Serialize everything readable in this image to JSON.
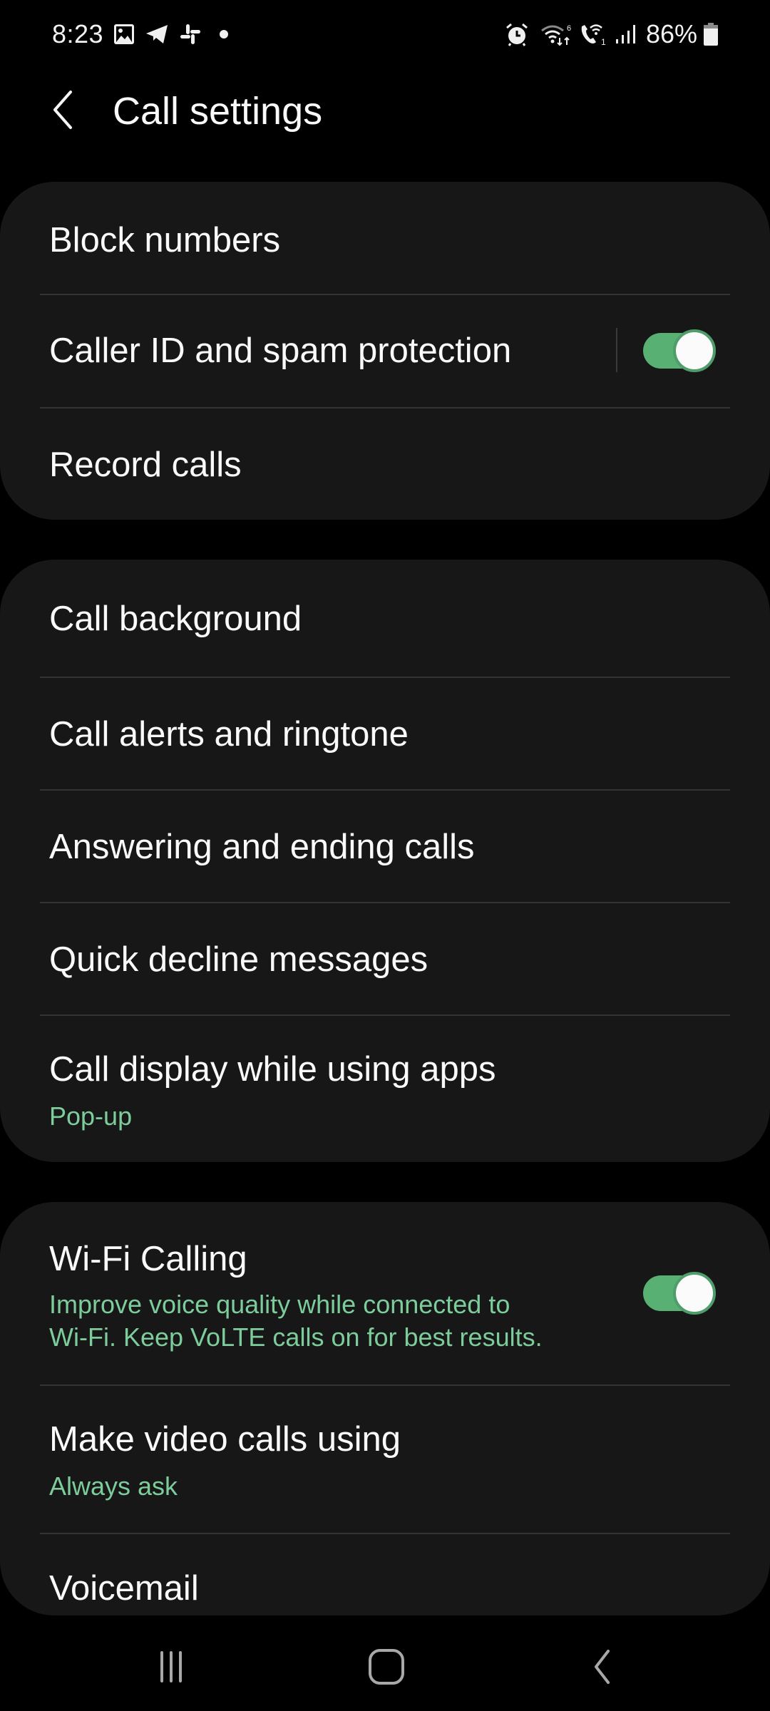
{
  "status_bar": {
    "time": "8:23",
    "left_icons": [
      "gallery-icon",
      "telegram-icon",
      "slack-icon",
      "notification-dot-icon"
    ],
    "right_icons": [
      "alarm-icon",
      "wifi-6-icon",
      "wifi-calling-icon",
      "signal-icon",
      "battery-icon"
    ],
    "wifi_calling_sim": "1",
    "wifi_generation": "6",
    "battery_percent": "86%"
  },
  "header": {
    "back_icon": "chevron-left-icon",
    "title": "Call settings"
  },
  "colors": {
    "accent": "#58b072",
    "subtext": "#7ccc9c",
    "card_bg": "#171717",
    "background": "#000000"
  },
  "groups": [
    {
      "items": [
        {
          "title": "Block numbers"
        },
        {
          "title": "Caller ID and spam protection",
          "toggle": true,
          "toggle_on": true
        },
        {
          "title": "Record calls"
        }
      ]
    },
    {
      "items": [
        {
          "title": "Call background"
        },
        {
          "title": "Call alerts and ringtone"
        },
        {
          "title": "Answering and ending calls"
        },
        {
          "title": "Quick decline messages"
        },
        {
          "title": "Call display while using apps",
          "subtitle": "Pop-up"
        }
      ]
    },
    {
      "items": [
        {
          "title": "Wi-Fi Calling",
          "subtitle_line1": "Improve voice quality while connected to",
          "subtitle_line2": "Wi-Fi. Keep VoLTE calls on for best results.",
          "toggle": true,
          "toggle_on": true
        },
        {
          "title": "Make video calls using",
          "subtitle": "Always ask"
        },
        {
          "title": "Voicemail"
        }
      ]
    }
  ],
  "nav_bar": {
    "recents": "recent-apps-icon",
    "home": "home-icon",
    "back": "back-icon"
  }
}
